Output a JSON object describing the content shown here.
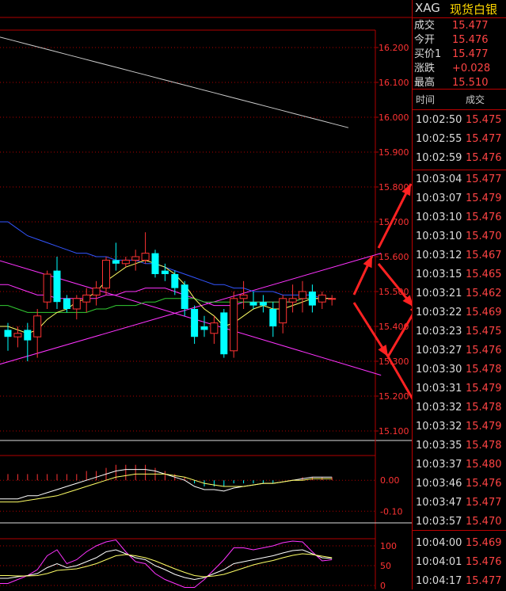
{
  "header": {
    "symbol": "XAG",
    "name": "现货白银"
  },
  "quote": [
    {
      "label": "成交",
      "value": "15.477"
    },
    {
      "label": "今开",
      "value": "15.476"
    },
    {
      "label": "买价1",
      "value": "15.477"
    },
    {
      "label": "涨跌",
      "value": "+0.028"
    },
    {
      "label": "最高",
      "value": "15.510"
    }
  ],
  "ticks_header": {
    "time": "时间",
    "price": "成交"
  },
  "ticks": [
    {
      "time": "10:02:50",
      "price": "15.475"
    },
    {
      "time": "10:02:55",
      "price": "15.477"
    },
    {
      "time": "10:02:59",
      "price": "15.476"
    },
    {
      "time": "10:03:04",
      "price": "15.477"
    },
    {
      "time": "10:03:07",
      "price": "15.479"
    },
    {
      "time": "10:03:10",
      "price": "15.476"
    },
    {
      "time": "10:03:10",
      "price": "15.470"
    },
    {
      "time": "10:03:12",
      "price": "15.467"
    },
    {
      "time": "10:03:15",
      "price": "15.465"
    },
    {
      "time": "10:03:21",
      "price": "15.462"
    },
    {
      "time": "10:03:22",
      "price": "15.469"
    },
    {
      "time": "10:03:23",
      "price": "15.475"
    },
    {
      "time": "10:03:27",
      "price": "15.476"
    },
    {
      "time": "10:03:30",
      "price": "15.478"
    },
    {
      "time": "10:03:31",
      "price": "15.479"
    },
    {
      "time": "10:03:32",
      "price": "15.478"
    },
    {
      "time": "10:03:32",
      "price": "15.479"
    },
    {
      "time": "10:03:35",
      "price": "15.478"
    },
    {
      "time": "10:03:37",
      "price": "15.480"
    },
    {
      "time": "10:03:46",
      "price": "15.476"
    },
    {
      "time": "10:03:47",
      "price": "15.477"
    },
    {
      "time": "10:03:57",
      "price": "15.470"
    },
    {
      "time": "10:04:00",
      "price": "15.469"
    },
    {
      "time": "10:04:01",
      "price": "15.476"
    },
    {
      "time": "10:04:17",
      "price": "15.477"
    }
  ],
  "main_axis": [
    "16.200",
    "16.100",
    "16.000",
    "15.900",
    "15.800",
    "15.700",
    "15.600",
    "15.500",
    "15.400",
    "15.300",
    "15.200",
    "15.100"
  ],
  "macd_axis": [
    "0.00",
    "-0.10"
  ],
  "kdj_axis": [
    "100",
    "50",
    "0"
  ],
  "colors": {
    "up": "#ff3333",
    "down": "#00ffff",
    "grid": "#b00000",
    "axis_text": "#ff3333",
    "accent": "#ffd700"
  },
  "chart_data": {
    "type": "candlestick",
    "ylim": [
      15.08,
      16.24
    ],
    "candles": [
      {
        "o": 15.39,
        "h": 15.41,
        "l": 15.33,
        "c": 15.37
      },
      {
        "o": 15.37,
        "h": 15.4,
        "l": 15.34,
        "c": 15.38
      },
      {
        "o": 15.39,
        "h": 15.41,
        "l": 15.3,
        "c": 15.36
      },
      {
        "o": 15.37,
        "h": 15.45,
        "l": 15.31,
        "c": 15.43
      },
      {
        "o": 15.47,
        "h": 15.56,
        "l": 15.45,
        "c": 15.55
      },
      {
        "o": 15.56,
        "h": 15.6,
        "l": 15.45,
        "c": 15.47
      },
      {
        "o": 15.48,
        "h": 15.49,
        "l": 15.44,
        "c": 15.45
      },
      {
        "o": 15.45,
        "h": 15.49,
        "l": 15.42,
        "c": 15.48
      },
      {
        "o": 15.47,
        "h": 15.51,
        "l": 15.44,
        "c": 15.49
      },
      {
        "o": 15.49,
        "h": 15.53,
        "l": 15.46,
        "c": 15.51
      },
      {
        "o": 15.51,
        "h": 15.6,
        "l": 15.49,
        "c": 15.59
      },
      {
        "o": 15.59,
        "h": 15.64,
        "l": 15.56,
        "c": 15.58
      },
      {
        "o": 15.58,
        "h": 15.6,
        "l": 15.57,
        "c": 15.59
      },
      {
        "o": 15.59,
        "h": 15.62,
        "l": 15.56,
        "c": 15.6
      },
      {
        "o": 15.59,
        "h": 15.67,
        "l": 15.58,
        "c": 15.61
      },
      {
        "o": 15.61,
        "h": 15.62,
        "l": 15.54,
        "c": 15.55
      },
      {
        "o": 15.56,
        "h": 15.58,
        "l": 15.53,
        "c": 15.55
      },
      {
        "o": 15.55,
        "h": 15.56,
        "l": 15.49,
        "c": 15.51
      },
      {
        "o": 15.52,
        "h": 15.53,
        "l": 15.43,
        "c": 15.45
      },
      {
        "o": 15.45,
        "h": 15.46,
        "l": 15.35,
        "c": 15.37
      },
      {
        "o": 15.4,
        "h": 15.43,
        "l": 15.37,
        "c": 15.39
      },
      {
        "o": 15.38,
        "h": 15.43,
        "l": 15.35,
        "c": 15.41
      },
      {
        "o": 15.44,
        "h": 15.45,
        "l": 15.31,
        "c": 15.32
      },
      {
        "o": 15.33,
        "h": 15.5,
        "l": 15.31,
        "c": 15.48
      },
      {
        "o": 15.48,
        "h": 15.53,
        "l": 15.45,
        "c": 15.49
      },
      {
        "o": 15.47,
        "h": 15.5,
        "l": 15.45,
        "c": 15.46
      },
      {
        "o": 15.47,
        "h": 15.49,
        "l": 15.44,
        "c": 15.46
      },
      {
        "o": 15.45,
        "h": 15.47,
        "l": 15.37,
        "c": 15.4
      },
      {
        "o": 15.41,
        "h": 15.49,
        "l": 15.38,
        "c": 15.48
      },
      {
        "o": 15.47,
        "h": 15.52,
        "l": 15.44,
        "c": 15.48
      },
      {
        "o": 15.48,
        "h": 15.53,
        "l": 15.44,
        "c": 15.5
      },
      {
        "o": 15.5,
        "h": 15.52,
        "l": 15.44,
        "c": 15.46
      },
      {
        "o": 15.47,
        "h": 15.5,
        "l": 15.45,
        "c": 15.49
      },
      {
        "o": 15.48,
        "h": 15.49,
        "l": 15.46,
        "c": 15.48
      }
    ],
    "ma_lines": [
      {
        "color": "#cccccc",
        "values": [
          16.23,
          16.22,
          16.21,
          16.2,
          16.19,
          16.18,
          16.17,
          16.16,
          16.15,
          16.14,
          16.13,
          16.12,
          16.11,
          16.1,
          16.09,
          16.08,
          16.07,
          16.06,
          16.05,
          16.04,
          16.03,
          16.02,
          16.01,
          16.0,
          15.99,
          15.98,
          15.97
        ]
      },
      {
        "color": "#3355ff",
        "values": [
          15.7,
          15.68,
          15.66,
          15.65,
          15.64,
          15.63,
          15.62,
          15.61,
          15.61,
          15.6,
          15.6,
          15.59,
          15.59,
          15.59,
          15.58,
          15.58,
          15.57,
          15.56,
          15.55,
          15.54,
          15.53,
          15.52,
          15.52,
          15.51,
          15.51,
          15.5,
          15.5,
          15.5,
          15.49,
          15.49,
          15.49,
          15.49,
          15.48,
          15.48
        ]
      },
      {
        "color": "#ff33ff",
        "values": [
          15.52,
          15.51,
          15.5,
          15.49,
          15.49,
          15.48,
          15.48,
          15.48,
          15.48,
          15.48,
          15.49,
          15.49,
          15.5,
          15.5,
          15.51,
          15.51,
          15.51,
          15.5,
          15.49,
          15.48,
          15.47,
          15.46,
          15.46,
          15.46,
          15.47,
          15.47,
          15.47,
          15.47,
          15.47,
          15.47,
          15.48,
          15.48,
          15.48,
          15.48
        ]
      },
      {
        "color": "#33cc33",
        "values": [
          15.46,
          15.45,
          15.44,
          15.44,
          15.44,
          15.44,
          15.44,
          15.44,
          15.44,
          15.45,
          15.45,
          15.46,
          15.46,
          15.46,
          15.47,
          15.47,
          15.48,
          15.48,
          15.48,
          15.48,
          15.47,
          15.47,
          15.47,
          15.47,
          15.47,
          15.47,
          15.47,
          15.47,
          15.47,
          15.47,
          15.48,
          15.48,
          15.48,
          15.48
        ]
      },
      {
        "color": "#ffff66",
        "values": [
          15.4,
          15.39,
          15.38,
          15.39,
          15.42,
          15.44,
          15.45,
          15.47,
          15.48,
          15.5,
          15.53,
          15.55,
          15.57,
          15.58,
          15.59,
          15.58,
          15.57,
          15.55,
          15.52,
          15.48,
          15.45,
          15.43,
          15.4,
          15.41,
          15.43,
          15.45,
          15.46,
          15.45,
          15.45,
          15.46,
          15.47,
          15.48,
          15.48,
          15.48
        ]
      }
    ],
    "trendlines": [
      {
        "color": "#ff33ff",
        "from": [
          -1,
          15.59
        ],
        "to": [
          38,
          15.26
        ]
      },
      {
        "color": "#ff33ff",
        "from": [
          -1,
          15.29
        ],
        "to": [
          38,
          15.61
        ]
      }
    ],
    "macd": {
      "hist": [
        0.02,
        0.02,
        0.02,
        0.02,
        0.02,
        0.02,
        0.02,
        0.02,
        0.03,
        0.03,
        0.04,
        0.05,
        0.05,
        0.05,
        0.05,
        0.04,
        0.03,
        0.02,
        0.01,
        -0.01,
        -0.02,
        -0.02,
        -0.02,
        -0.01,
        -0.01,
        -0.01,
        -0.01,
        -0.01,
        0.0,
        0.0,
        0.01,
        0.01,
        0.01,
        0.01
      ],
      "dif": [
        -0.06,
        -0.06,
        -0.05,
        -0.05,
        -0.04,
        -0.03,
        -0.02,
        -0.01,
        0.0,
        0.01,
        0.02,
        0.03,
        0.035,
        0.035,
        0.035,
        0.03,
        0.02,
        0.01,
        0.0,
        -0.02,
        -0.03,
        -0.03,
        -0.035,
        -0.025,
        -0.02,
        -0.015,
        -0.01,
        -0.01,
        -0.005,
        0.0,
        0.005,
        0.01,
        0.01,
        0.01
      ],
      "dea": [
        -0.07,
        -0.07,
        -0.065,
        -0.06,
        -0.055,
        -0.05,
        -0.04,
        -0.03,
        -0.02,
        -0.01,
        0.0,
        0.01,
        0.015,
        0.02,
        0.02,
        0.02,
        0.02,
        0.015,
        0.01,
        0.0,
        -0.01,
        -0.015,
        -0.02,
        -0.02,
        -0.02,
        -0.015,
        -0.01,
        -0.01,
        -0.005,
        0.0,
        0.0,
        0.005,
        0.005,
        0.005
      ],
      "ylim": [
        -0.13,
        0.08
      ]
    },
    "kdj": {
      "k": [
        18,
        22,
        25,
        30,
        45,
        55,
        45,
        50,
        60,
        70,
        85,
        90,
        80,
        70,
        65,
        50,
        40,
        28,
        20,
        15,
        20,
        30,
        40,
        55,
        60,
        65,
        70,
        75,
        82,
        88,
        90,
        80,
        70,
        68
      ],
      "d": [
        25,
        24,
        24,
        25,
        30,
        38,
        40,
        42,
        48,
        55,
        65,
        75,
        78,
        75,
        70,
        62,
        52,
        42,
        33,
        25,
        22,
        24,
        28,
        36,
        44,
        52,
        58,
        63,
        70,
        76,
        80,
        78,
        74,
        70
      ],
      "j": [
        5,
        15,
        25,
        40,
        75,
        90,
        55,
        65,
        85,
        100,
        110,
        115,
        85,
        60,
        55,
        30,
        15,
        5,
        -5,
        -5,
        15,
        40,
        65,
        95,
        95,
        90,
        95,
        100,
        108,
        112,
        110,
        85,
        62,
        65
      ],
      "ylim": [
        -10,
        118
      ]
    }
  }
}
